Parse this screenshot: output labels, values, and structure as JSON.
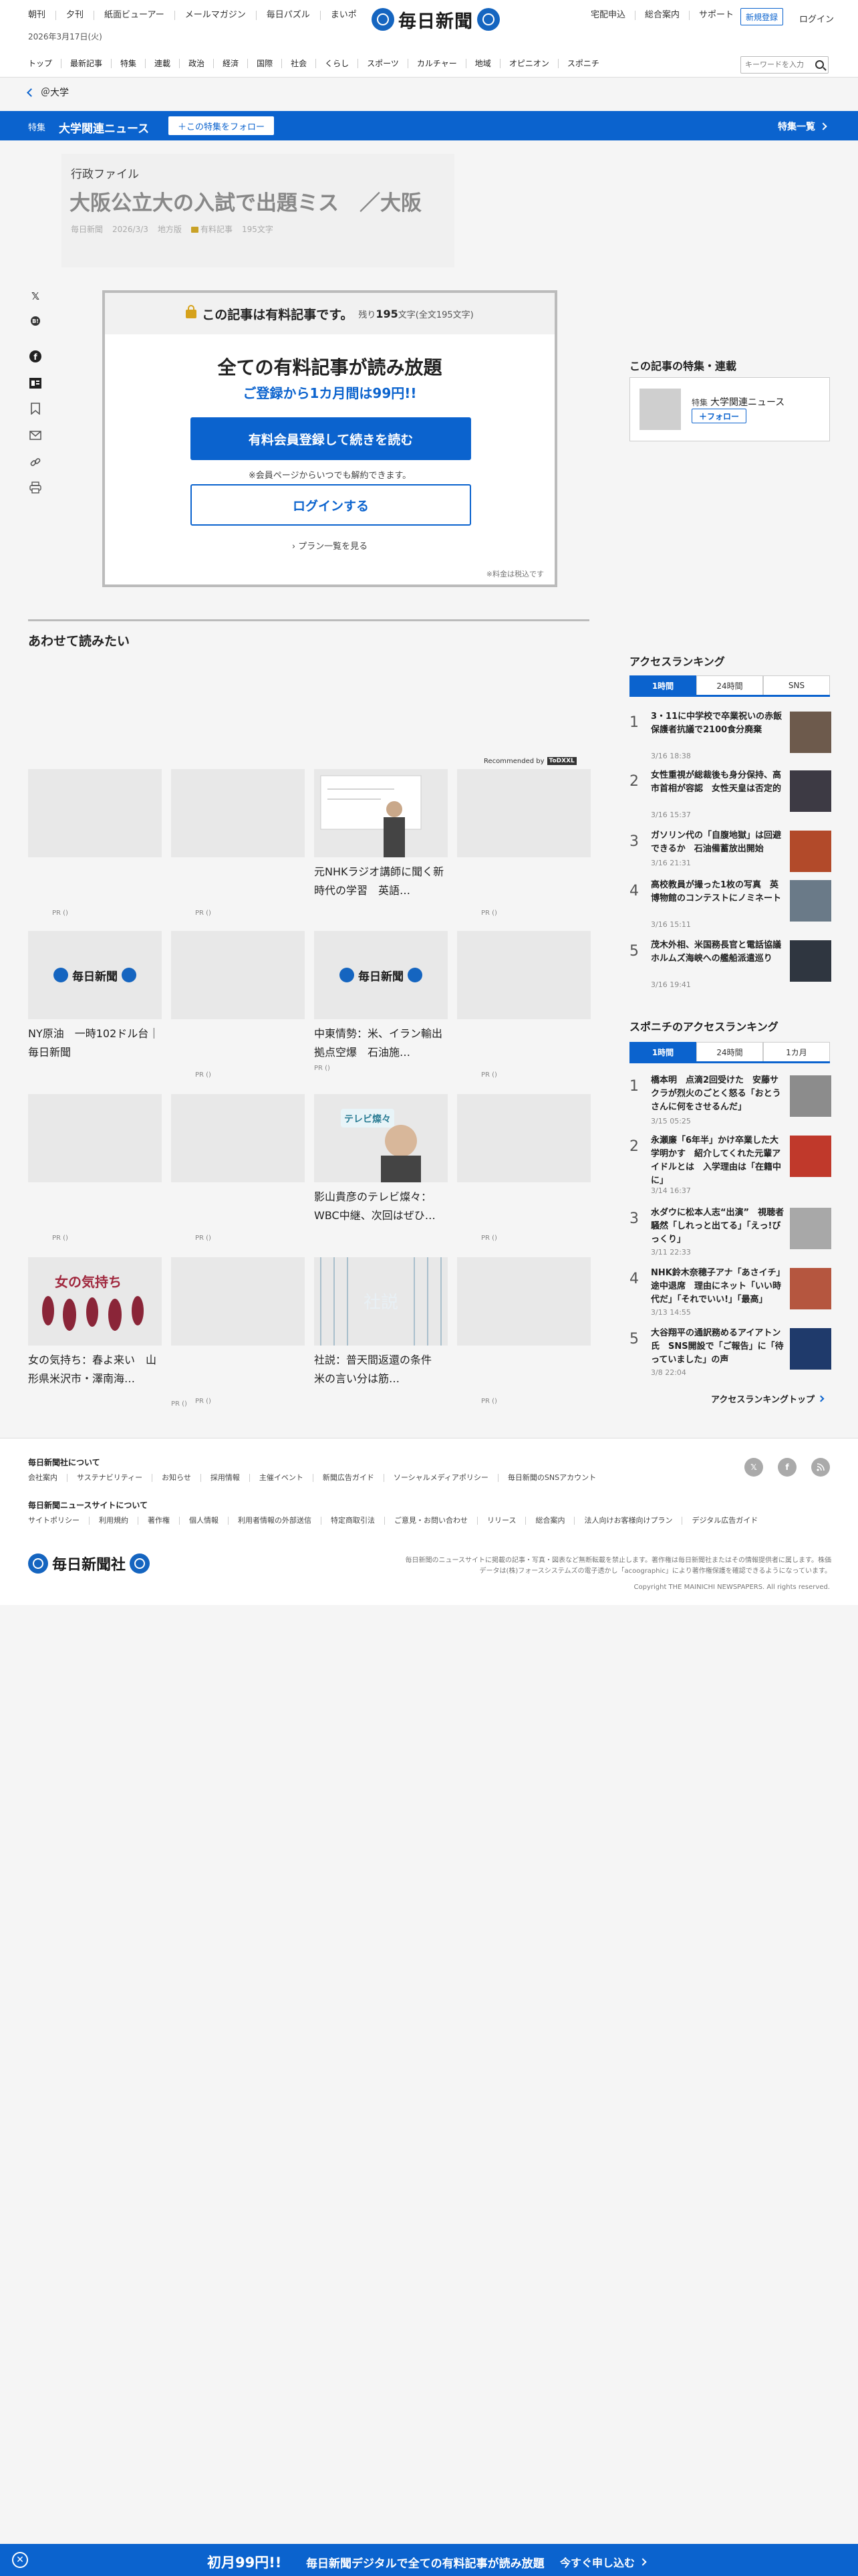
{
  "header": {
    "top_links": [
      "朝刊",
      "夕刊",
      "紙面ビューアー",
      "メールマガジン",
      "毎日パズル",
      "まいポ"
    ],
    "date": "2026年3月17日(火)",
    "logo": "毎日新聞",
    "right_links": [
      "宅配申込",
      "総合案内",
      "サポート"
    ],
    "register": "新規登録",
    "login": "ログイン",
    "nav": [
      "トップ",
      "最新記事",
      "特集",
      "連載",
      "政治",
      "経済",
      "国際",
      "社会",
      "くらし",
      "スポーツ",
      "カルチャー",
      "地域",
      "オピニオン",
      "スポニチ"
    ],
    "search_placeholder": "キーワードを入力"
  },
  "breadcrumb": "＠大学",
  "feature_bar": {
    "tag": "特集",
    "title": "大学関連ニュース",
    "follow": "＋この特集をフォロー",
    "list": "特集一覧"
  },
  "article": {
    "category": "行政ファイル",
    "title": "大阪公立大の入試で出題ミス　／大阪",
    "source": "毎日新聞",
    "date": "2026/3/3",
    "region": "地方版",
    "paid": "有料記事",
    "chars": "195文字"
  },
  "share_icons": [
    "x-icon",
    "hatena-icon",
    "facebook-icon",
    "note-icon",
    "bookmark-icon",
    "mail-icon",
    "link-icon",
    "print-icon"
  ],
  "paywall": {
    "notice": "この記事は有料記事です。",
    "remaining_prefix": "残り",
    "remaining_num": "195",
    "remaining_suffix": "文字(全文195文字)",
    "headline": "全ての有料記事が読み放題",
    "sub": "ご登録から1カ月間は99円!!",
    "primary": "有料会員登録して続きを読む",
    "note": "※会員ページからいつでも解約できます。",
    "login": "ログインする",
    "plan": "プラン一覧を見る",
    "tax": "※料金は税込です"
  },
  "related": {
    "title": "あわせて読みたい",
    "recommended": "Recommended by",
    "rec_logo": "ToDXXL",
    "cards": [
      {
        "text": "",
        "pr": "PR ()"
      },
      {
        "text": "",
        "pr": "PR ()"
      },
      {
        "text": "元NHKラジオ講師に聞く新時代の学習　英語…",
        "pr": "PR ()"
      },
      {
        "text": "",
        "pr": ""
      },
      {
        "text": "",
        "pr": "PR ()"
      },
      {
        "text": "",
        "pr": "PR ()"
      },
      {
        "text": "NY原油　一時102ドル台｜毎日新聞",
        "pr": ""
      },
      {
        "text": "",
        "pr": "PR ()"
      },
      {
        "text": "中東情勢：米、イラン輸出拠点空爆　石油施…",
        "pr": "PR ()"
      },
      {
        "text": "",
        "pr": "PR ()"
      },
      {
        "text": "",
        "pr": "PR ()"
      },
      {
        "text": "",
        "pr": "PR ()"
      },
      {
        "text": "影山貴彦のテレビ燦々：WBC中継、次回はぜひ…",
        "pr": ""
      },
      {
        "text": "",
        "pr": "PR ()"
      },
      {
        "text": "女の気持ち：春よ来い　山形県米沢市・澤南海…",
        "pr": ""
      },
      {
        "text": "",
        "pr": "PR ()"
      },
      {
        "text": "社説：普天間返還の条件　米の言い分は筋…",
        "pr": ""
      },
      {
        "text": "",
        "pr": "PR ()"
      }
    ],
    "thumb_logo": "毎日新聞",
    "tv_caption": "テレビ燦々",
    "women_caption": "女の気持ち",
    "editorial_caption": "社説"
  },
  "sidebar": {
    "feature_title": "この記事の特集・連載",
    "feature_tag": "特集",
    "feature_name": "大学関連ニュース",
    "feature_follow": "＋フォロー",
    "access_title": "アクセスランキング",
    "access_tabs": [
      "1時間",
      "24時間",
      "SNS"
    ],
    "access": [
      {
        "num": "1",
        "title": "3・11に中学校で卒業祝いの赤飯　保護者抗議で2100食分廃棄",
        "date": "3/16 18:38"
      },
      {
        "num": "2",
        "title": "女性重視が総裁後も身分保持、高市首相が容認　女性天皇は否定的",
        "date": "3/16 15:37"
      },
      {
        "num": "3",
        "title": "ガソリン代の「自腹地獄」は回避できるか　石油備蓄放出開始",
        "date": "3/16 21:31"
      },
      {
        "num": "4",
        "title": "高校教員が撮った1枚の写真　英博物館のコンテストにノミネート",
        "date": "3/16 15:11"
      },
      {
        "num": "5",
        "title": "茂木外相、米国務長官と電話協議　ホルムズ海峡への艦船派遣巡り",
        "date": "3/16 19:41"
      }
    ],
    "sponichi_title": "スポニチのアクセスランキング",
    "sponichi_tabs": [
      "1時間",
      "24時間",
      "1カ月"
    ],
    "sponichi": [
      {
        "num": "1",
        "title": "橋本明　点滴2回受けた　安藤サクラが烈火のごとく怒る「おとうさんに何をさせるんだ」",
        "date": "3/15 05:25"
      },
      {
        "num": "2",
        "title": "永瀬廉「6年半」かけ卒業した大学明かす　紹介してくれた元輩アイドルとは　入学理由は「在籍中に」",
        "date": "3/14 16:37"
      },
      {
        "num": "3",
        "title": "水ダウに松本人志“出演”　視聴者騒然「しれっと出てる」「えっ!びっくり」",
        "date": "3/11 22:33"
      },
      {
        "num": "4",
        "title": "NHK鈴木奈穂子アナ「あさイチ」途中退席　理由にネット「いい時代だ」「それでいい!」「最高」",
        "date": "3/13 14:55"
      },
      {
        "num": "5",
        "title": "大谷翔平の通訳務めるアイアトン氏　SNS開設で「ご報告」に「待っていました」の声",
        "date": "3/8 22:04"
      }
    ],
    "more": "アクセスランキングトップ"
  },
  "footer": {
    "about_title": "毎日新聞社について",
    "about_links": [
      "会社案内",
      "サステナビリティー",
      "お知らせ",
      "採用情報",
      "主催イベント",
      "新聞広告ガイド",
      "ソーシャルメディアポリシー",
      "毎日新聞のSNSアカウント"
    ],
    "site_title": "毎日新聞ニュースサイトについて",
    "site_links": [
      "サイトポリシー",
      "利用規約",
      "著作権",
      "個人情報",
      "利用者情報の外部送信",
      "特定商取引法",
      "ご意見・お問い合わせ",
      "リリース",
      "総合案内",
      "法人向けお客様向けプラン",
      "デジタル広告ガイド"
    ],
    "logo": "毎日新聞社",
    "note": "毎日新聞のニュースサイトに掲載の記事・写真・図表など無断転載を禁止します。著作権は毎日新聞社またはその情報提供者に属します。株価データは(株)フォースシステムズの電子透かし「acoographic」により著作権保護を確認できるようになっています。",
    "copyright": "Copyright THE MAINICHI NEWSPAPERS. All rights reserved."
  },
  "bottom_bar": {
    "price": "初月99円!!",
    "text": "毎日新聞デジタルで全ての有料記事が読み放題",
    "cta": "今すぐ申し込む"
  }
}
